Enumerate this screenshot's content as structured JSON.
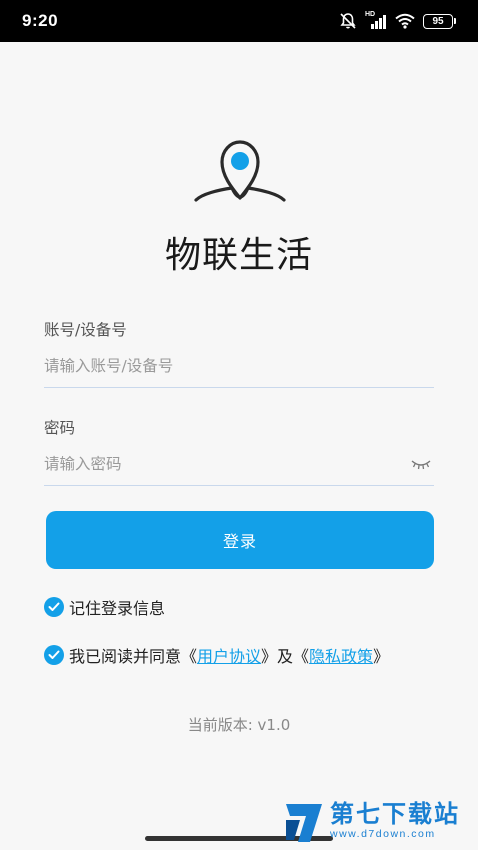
{
  "status_bar": {
    "time": "9:20",
    "network_label": "HD",
    "battery": "95",
    "icons": [
      "bell-muted-icon",
      "signal-icon",
      "wifi-icon",
      "battery-icon"
    ]
  },
  "app": {
    "title": "物联生活",
    "logo_icon": "location-pin-icon",
    "accent_color": "#13a0e8"
  },
  "form": {
    "account_label": "账号/设备号",
    "account_placeholder": "请输入账号/设备号",
    "password_label": "密码",
    "password_placeholder": "请输入密码",
    "password_toggle_icon": "eye-closed-icon",
    "login_label": "登录"
  },
  "options": {
    "remember_label": "记住登录信息",
    "remember_checked": true,
    "agree_prefix": "我已阅读并同意《",
    "user_agreement": "用户协议",
    "agree_middle": "》及《",
    "privacy_policy": "隐私政策",
    "agree_suffix": "》",
    "agree_checked": true
  },
  "version": "当前版本: v1.0",
  "watermark": {
    "name": "第七下载站",
    "url": "www.d7down.com"
  }
}
